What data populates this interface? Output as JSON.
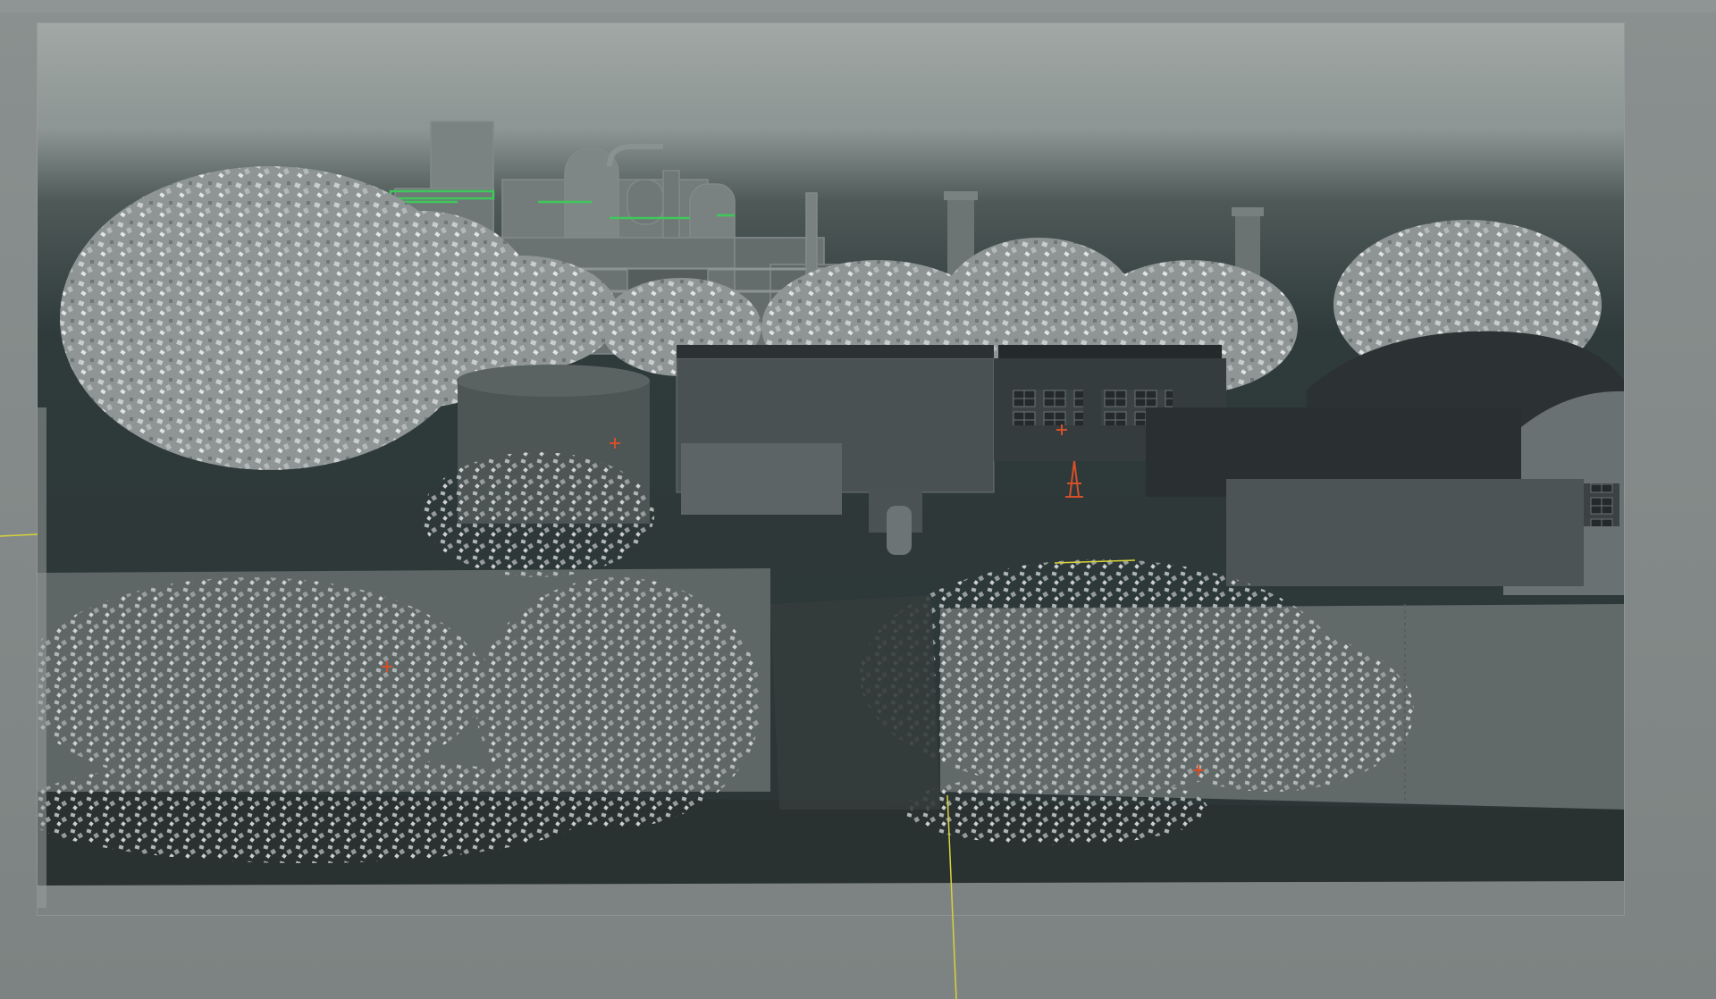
{
  "viewport": {
    "kind": "3d-scene-viewport",
    "render_style": "smooth-shaded-default-material",
    "resolution_gate_visible": true,
    "gate_mask_visible": true
  },
  "scene": {
    "objects": [
      "industrial-refinery",
      "smokestack",
      "smokestack",
      "deciduous-tree",
      "deciduous-tree",
      "deciduous-tree",
      "tree-line",
      "warehouse-flat-building",
      "quonset-hangar",
      "storage-tank",
      "perimeter-wall",
      "overgrown-ivy",
      "overgrown-ivy",
      "ground-plane",
      "locator",
      "transmission-tower"
    ]
  },
  "colors": {
    "outer_background": "#868c8b",
    "sky_top": "#a3aaa8",
    "sky_bottom": "#2f3a3a",
    "foliage": "#a6acab",
    "foliage_highlight": "#dfe3e2",
    "building_dark": "#2d3334",
    "building_mid": "#5c6364",
    "wall": "#646a6a",
    "ground": "#2a3131",
    "selection_green": "#3fc85a",
    "locator_orange": "#d4502a",
    "axis_yellow": "#d8d23a"
  },
  "icons": {
    "locator": "locator-cross-icon",
    "tower": "transmission-tower-icon"
  }
}
